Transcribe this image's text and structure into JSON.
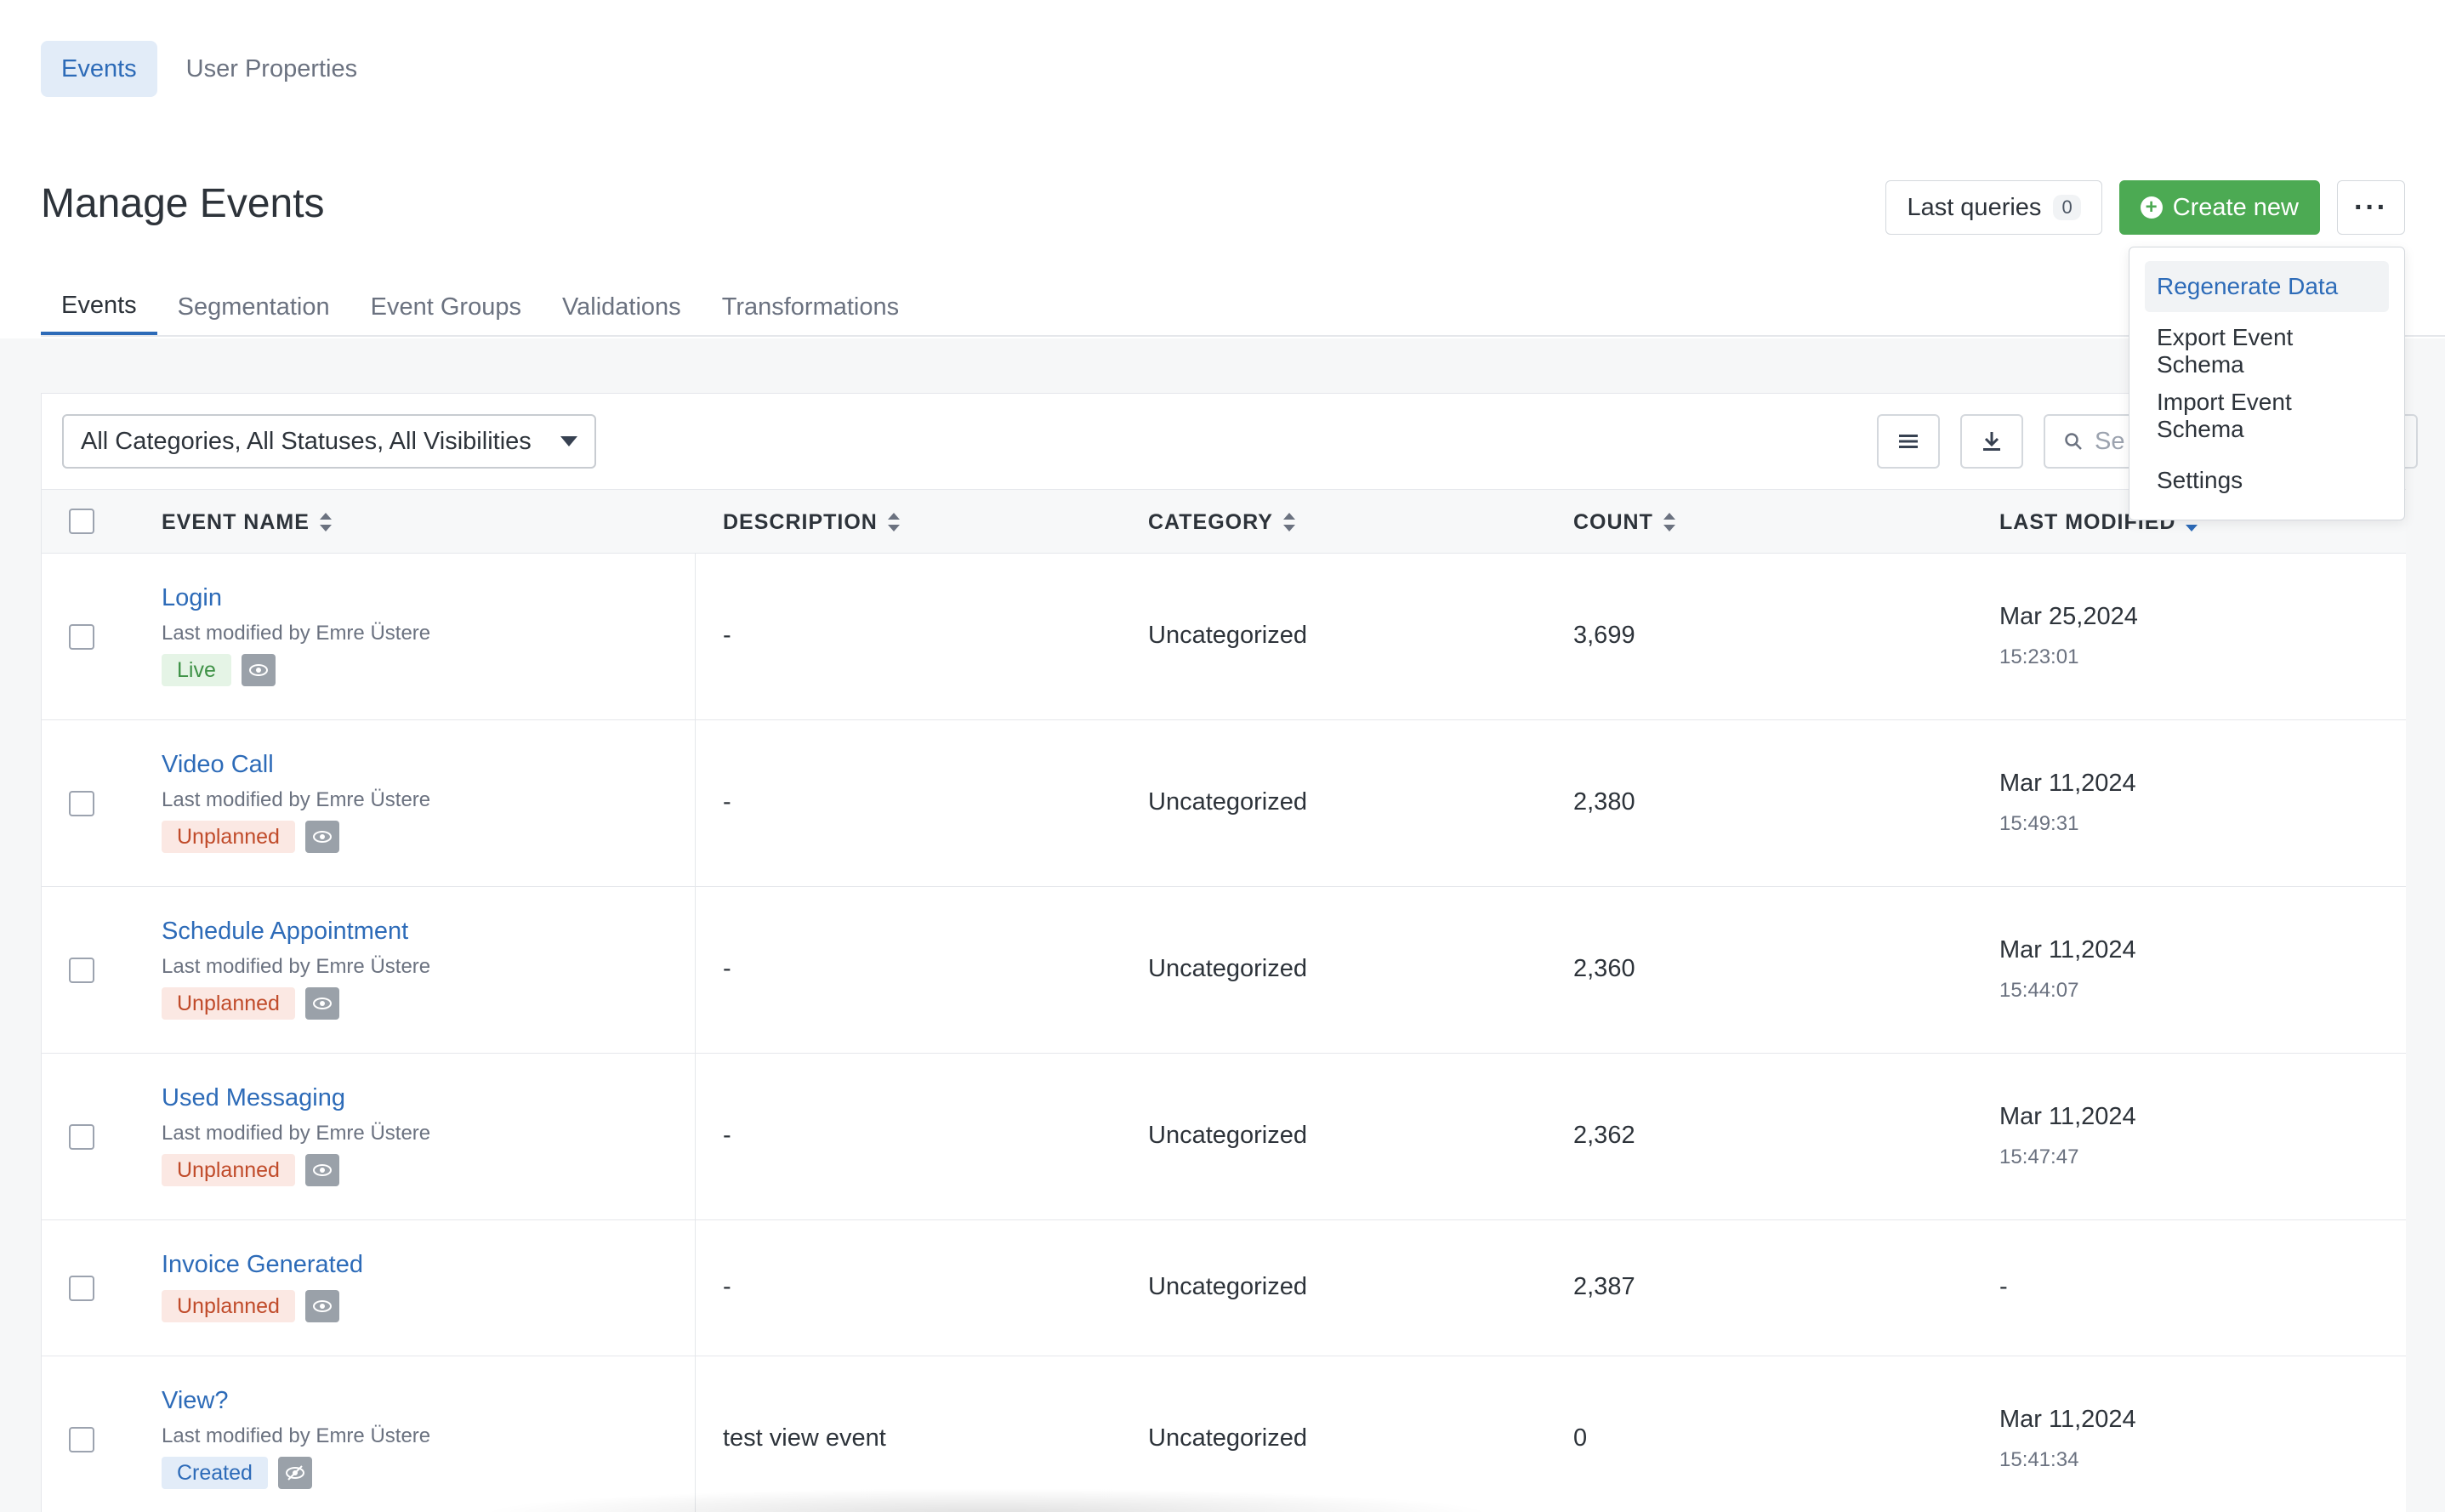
{
  "top_nav": {
    "items": [
      {
        "label": "Events",
        "active": true
      },
      {
        "label": "User Properties",
        "active": false
      }
    ]
  },
  "header": {
    "title": "Manage Events",
    "last_queries_label": "Last queries",
    "last_queries_count": "0",
    "create_label": "Create new",
    "more_label": "···"
  },
  "tabs": [
    "Events",
    "Segmentation",
    "Event Groups",
    "Validations",
    "Transformations"
  ],
  "filter": {
    "value": "All Categories, All Statuses, All Visibilities"
  },
  "search": {
    "placeholder": "Se"
  },
  "dropdown": {
    "items": [
      "Regenerate Data",
      "Export Event Schema",
      "Import Event Schema",
      "Settings"
    ]
  },
  "table": {
    "columns": [
      "EVENT NAME",
      "DESCRIPTION",
      "CATEGORY",
      "COUNT",
      "LAST MODIFIED"
    ],
    "rows": [
      {
        "name": "Login",
        "modified_by": "Last modified by Emre Üstere",
        "status": "Live",
        "description": "-",
        "category": "Uncategorized",
        "count": "3,699",
        "date": "Mar 25,2024",
        "time": "15:23:01"
      },
      {
        "name": "Video Call",
        "modified_by": "Last modified by Emre Üstere",
        "status": "Unplanned",
        "description": "-",
        "category": "Uncategorized",
        "count": "2,380",
        "date": "Mar 11,2024",
        "time": "15:49:31"
      },
      {
        "name": "Schedule Appointment",
        "modified_by": "Last modified by Emre Üstere",
        "status": "Unplanned",
        "description": "-",
        "category": "Uncategorized",
        "count": "2,360",
        "date": "Mar 11,2024",
        "time": "15:44:07"
      },
      {
        "name": "Used Messaging",
        "modified_by": "Last modified by Emre Üstere",
        "status": "Unplanned",
        "description": "-",
        "category": "Uncategorized",
        "count": "2,362",
        "date": "Mar 11,2024",
        "time": "15:47:47"
      },
      {
        "name": "Invoice Generated",
        "modified_by": "",
        "status": "Unplanned",
        "description": "-",
        "category": "Uncategorized",
        "count": "2,387",
        "date": "-",
        "time": ""
      },
      {
        "name": "View?",
        "modified_by": "Last modified by Emre Üstere",
        "status": "Created",
        "description": "test view event",
        "category": "Uncategorized",
        "count": "0",
        "date": "Mar 11,2024",
        "time": "15:41:34"
      }
    ]
  },
  "colors": {
    "accent": "#2d6bb8",
    "create": "#4caa53",
    "live": "#3f9247",
    "unplanned": "#c04b2a"
  }
}
